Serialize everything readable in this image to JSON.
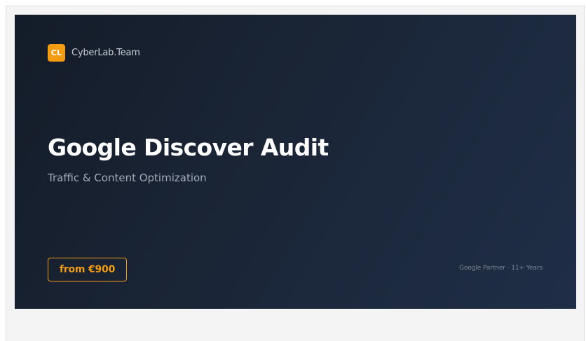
{
  "brand": {
    "logo_text": "CL",
    "name": "CyberLab.Team"
  },
  "hero": {
    "title": "Google Discover Audit",
    "subtitle": "Traffic & Content Optimization",
    "price_label": "from €900",
    "footer_note": "Google Partner · 11+ Years"
  },
  "colors": {
    "accent": "#f39c12",
    "hero_background_start": "#141c29",
    "hero_background_end": "#1f2e47",
    "title": "#ffffff",
    "subtitle": "#a3abb8"
  }
}
